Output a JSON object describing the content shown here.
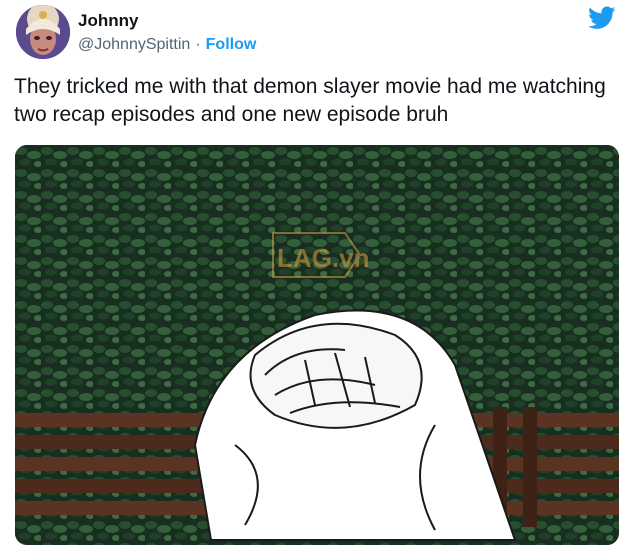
{
  "author": {
    "display_name": "Johnny",
    "handle": "@JohnnySpittin",
    "separator": "·",
    "follow_label": "Follow"
  },
  "tweet": {
    "text": "They tricked me with that demon slayer movie had me watching two recap episodes and one new episode bruh"
  },
  "media": {
    "watermark": "LAG.vn"
  },
  "icons": {
    "platform": "twitter-bird-icon",
    "avatar": "avatar"
  },
  "colors": {
    "accent": "#1d9bf0",
    "text": "#0f1419",
    "secondary_text": "#536471",
    "foliage": "#1f3a28",
    "bench": "#4a2a1a"
  }
}
